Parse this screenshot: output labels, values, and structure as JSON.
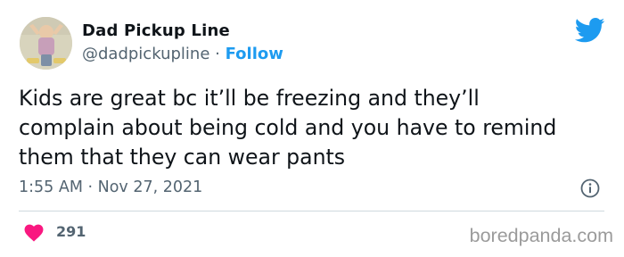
{
  "author": {
    "name": "Dad Pickup Line",
    "handle": "@dadpickupline",
    "separator": "·",
    "follow_label": "Follow",
    "avatar_icon": "avatar-image"
  },
  "brand_icon": "twitter-bird-icon",
  "tweet": {
    "lines": [
      "Kids are great bc it’ll be freezing and they’ll",
      "complain about being cold and you have to remind",
      "them that they can wear pants"
    ],
    "timestamp": "1:55 AM · Nov 27, 2021"
  },
  "engagement": {
    "like_icon": "heart-icon",
    "like_count": "291",
    "info_icon": "info-icon"
  },
  "watermark": "boredpanda.com",
  "colors": {
    "accent": "#1d9bf0",
    "like": "#f91880",
    "secondary_text": "#536471",
    "divider": "#cfd9de"
  }
}
